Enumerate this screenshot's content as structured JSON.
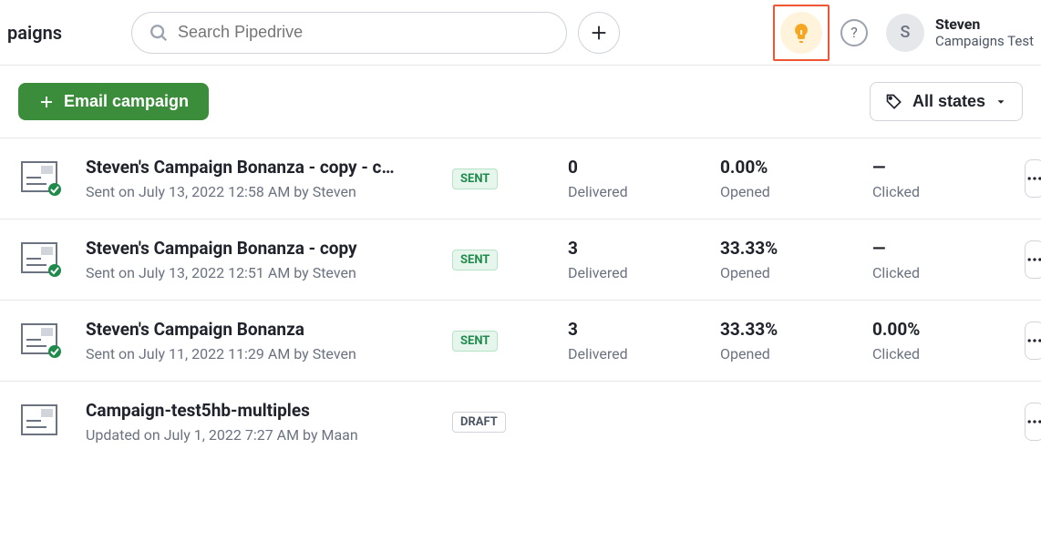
{
  "header": {
    "page_title_fragment": "paigns",
    "search_placeholder": "Search Pipedrive",
    "user_name": "Steven",
    "user_subtitle": "Campaigns Test",
    "user_initial": "S"
  },
  "toolbar": {
    "email_campaign_label": "Email campaign",
    "filter_label": "All states"
  },
  "status_badges": {
    "sent": "SENT",
    "draft": "DRAFT"
  },
  "stat_labels": {
    "delivered": "Delivered",
    "opened": "Opened",
    "clicked": "Clicked"
  },
  "campaigns": [
    {
      "name": "Steven's Campaign Bonanza - copy - c…",
      "subtitle": "Sent on July 13, 2022 12:58 AM by Steven",
      "status": "SENT",
      "delivered": "0",
      "opened": "0.00%",
      "clicked": "—"
    },
    {
      "name": "Steven's Campaign Bonanza - copy",
      "subtitle": "Sent on July 13, 2022 12:51 AM by Steven",
      "status": "SENT",
      "delivered": "3",
      "opened": "33.33%",
      "clicked": "—"
    },
    {
      "name": "Steven's Campaign Bonanza",
      "subtitle": "Sent on July 11, 2022 11:29 AM by Steven",
      "status": "SENT",
      "delivered": "3",
      "opened": "33.33%",
      "clicked": "0.00%"
    },
    {
      "name": "Campaign-test5hb-multiples",
      "subtitle": "Updated on July 1, 2022 7:27 AM by Maan",
      "status": "DRAFT",
      "delivered": "",
      "opened": "",
      "clicked": ""
    }
  ]
}
